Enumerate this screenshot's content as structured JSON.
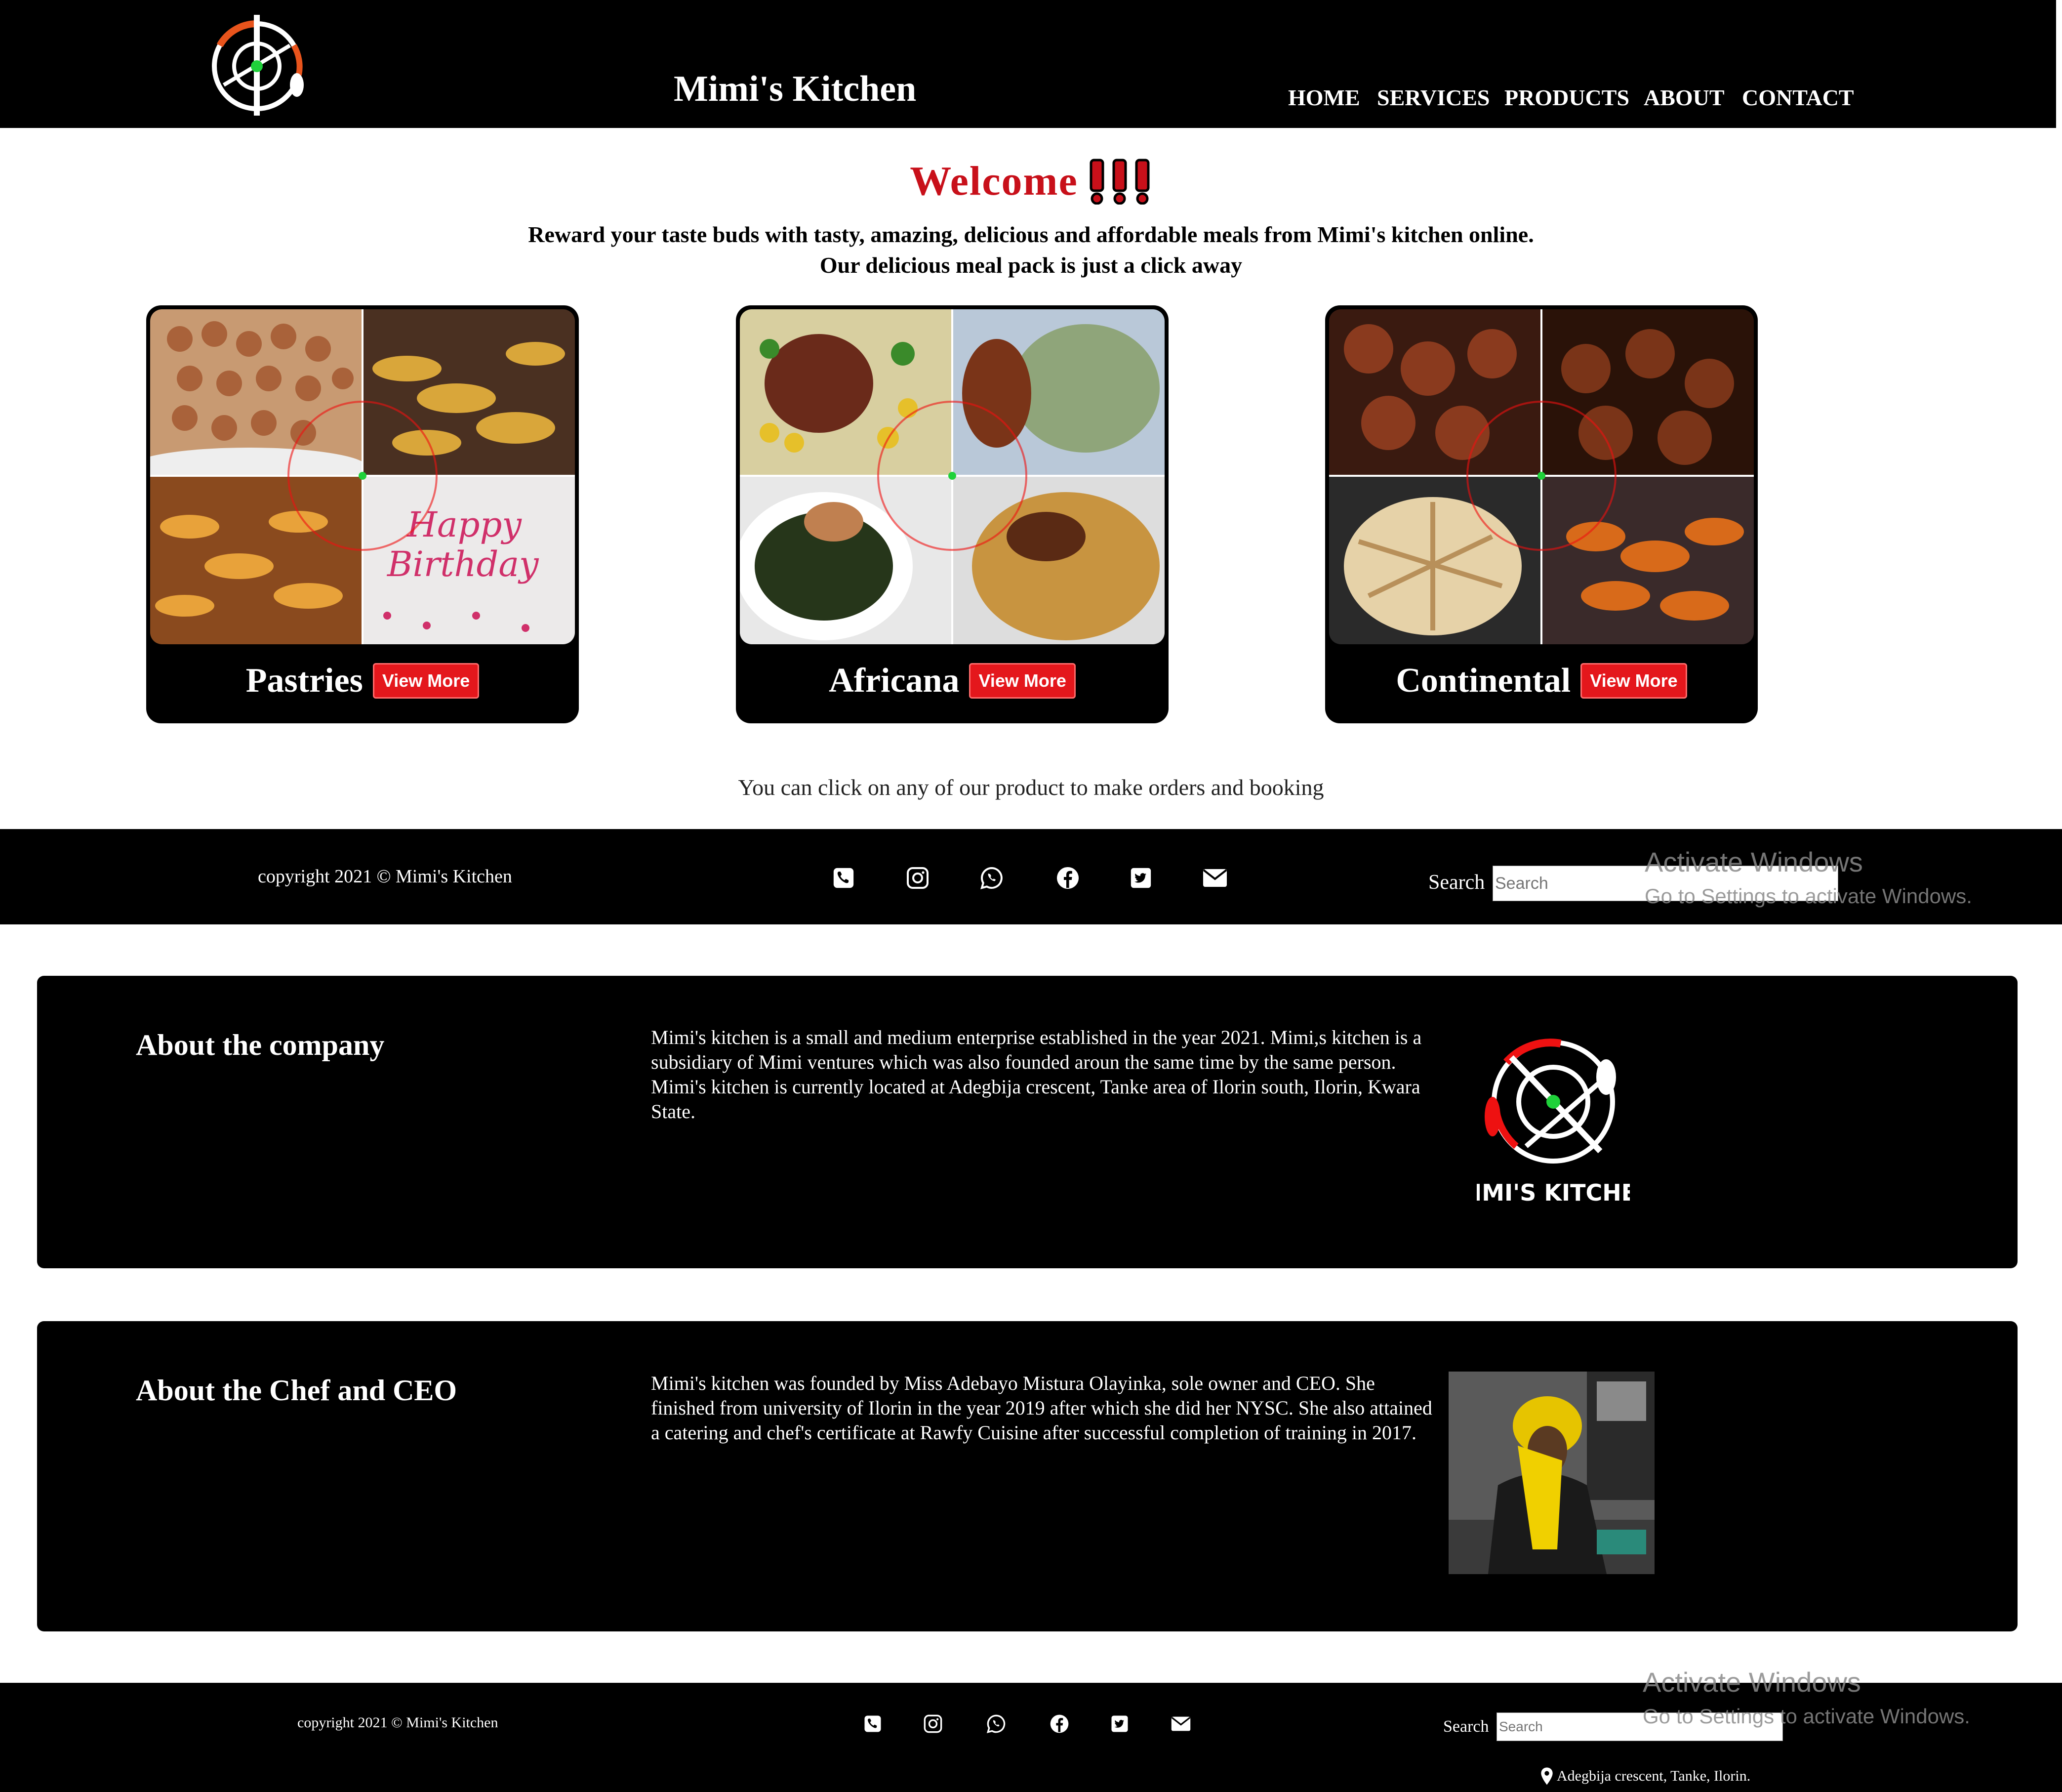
{
  "header": {
    "site_title": "Mimi's Kitchen",
    "nav": [
      "HOME",
      "SERVICES",
      "PRODUCTS",
      "ABOUT",
      "CONTACT"
    ]
  },
  "hero": {
    "welcome": "Welcome",
    "welcome_marks": "!!!",
    "line1": "Reward your taste buds with tasty, amazing, delicious and affordable meals from Mimi's kitchen online.",
    "line2": "Our delicious meal pack is just a click away"
  },
  "products": [
    {
      "title": "Pastries",
      "button": "View More"
    },
    {
      "title": "Africana",
      "button": "View More"
    },
    {
      "title": "Continental",
      "button": "View More"
    }
  ],
  "order_note": "You can click on any of our product to make orders and booking",
  "footer": {
    "copyright": "copyright 2021 © Mimi's Kitchen",
    "search_label": "Search",
    "search_placeholder": "Search",
    "social_icons": [
      "phone-icon",
      "instagram-icon",
      "whatsapp-icon",
      "facebook-icon",
      "twitter-icon",
      "mail-icon"
    ],
    "watermark_title": "Activate Windows",
    "watermark_sub": "Go to Settings to activate Windows."
  },
  "about_company": {
    "heading": "About the company",
    "text": "Mimi's kitchen is a small and medium enterprise established in the year 2021. Mimi,s kitchen is a subsidiary of Mimi ventures which was also founded aroun the same time by the same person. Mimi's kitchen is currently located at Adegbija crescent, Tanke area of Ilorin south, Ilorin, Kwara State.",
    "logo_text": "MIMI'S KITCHEN"
  },
  "about_ceo": {
    "heading": "About the Chef and CEO",
    "text": "Mimi's kitchen was founded by Miss Adebayo Mistura Olayinka, sole owner and CEO. She finished from university of Ilorin in the year 2019 after which she did her NYSC. She also attained a catering and chef's certificate at Rawfy Cuisine after successful completion of training in 2017."
  },
  "address": "Adegbija crescent, Tanke, Ilorin.",
  "colors": {
    "accent_red": "#e4171c",
    "welcome_red": "#c8101a",
    "logo_green": "#1fd13a",
    "logo_orange": "#e8541c"
  }
}
